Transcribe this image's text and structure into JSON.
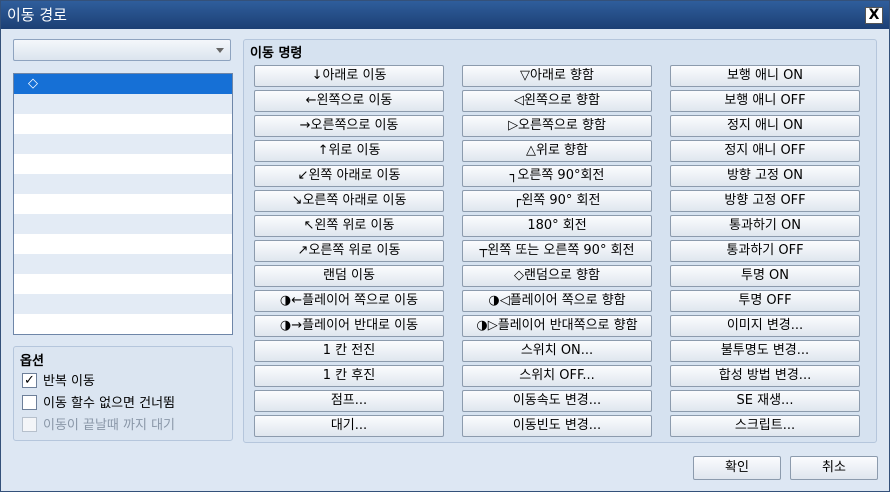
{
  "window": {
    "title": "이동 경로",
    "close_label": "X"
  },
  "target_combo": {
    "value": ""
  },
  "route_list": {
    "selected_item": "◇",
    "empty_rows": 12
  },
  "options": {
    "title": "옵션",
    "items": [
      {
        "label": "반복 이동",
        "checked": true,
        "enabled": true
      },
      {
        "label": "이동 할수 없으면 건너뜀",
        "checked": false,
        "enabled": true
      },
      {
        "label": "이동이 끝날때 까지 대기",
        "checked": false,
        "enabled": false
      }
    ]
  },
  "commands": {
    "title": "이동 명령",
    "columns": [
      [
        "↓아래로 이동",
        "←왼쪽으로 이동",
        "→오른쪽으로 이동",
        "↑위로 이동",
        "↙왼쪽 아래로 이동",
        "↘오른쪽 아래로 이동",
        "↖왼쪽 위로 이동",
        "↗오른쪽 위로 이동",
        "랜덤 이동",
        "◑←플레이어 쪽으로 이동",
        "◑→플레이어 반대로 이동",
        "1 칸 전진",
        "1 칸 후진",
        "점프...",
        "대기..."
      ],
      [
        "▽아래로 향함",
        "◁왼쪽으로 향함",
        "▷오른쪽으로 향함",
        "△위로 향함",
        "┐오른쪽 90°회전",
        "┌왼쪽 90° 회전",
        "180° 회전",
        "┬왼쪽 또는 오른쪽 90° 회전",
        "◇랜덤으로 향함",
        "◑◁플레이어 쪽으로 향함",
        "◑▷플레이어 반대쪽으로 향함",
        "스위치 ON...",
        "스위치 OFF...",
        "이동속도 변경...",
        "이동빈도 변경..."
      ],
      [
        "보행 애니 ON",
        "보행 애니 OFF",
        "정지 애니 ON",
        "정지 애니 OFF",
        "방향 고정 ON",
        "방향 고정 OFF",
        "통과하기 ON",
        "통과하기 OFF",
        "투명 ON",
        "투명 OFF",
        "이미지 변경...",
        "불투명도 변경...",
        "합성 방법 변경...",
        "SE 재생...",
        "스크립트..."
      ]
    ]
  },
  "footer": {
    "ok_label": "확인",
    "cancel_label": "취소"
  }
}
